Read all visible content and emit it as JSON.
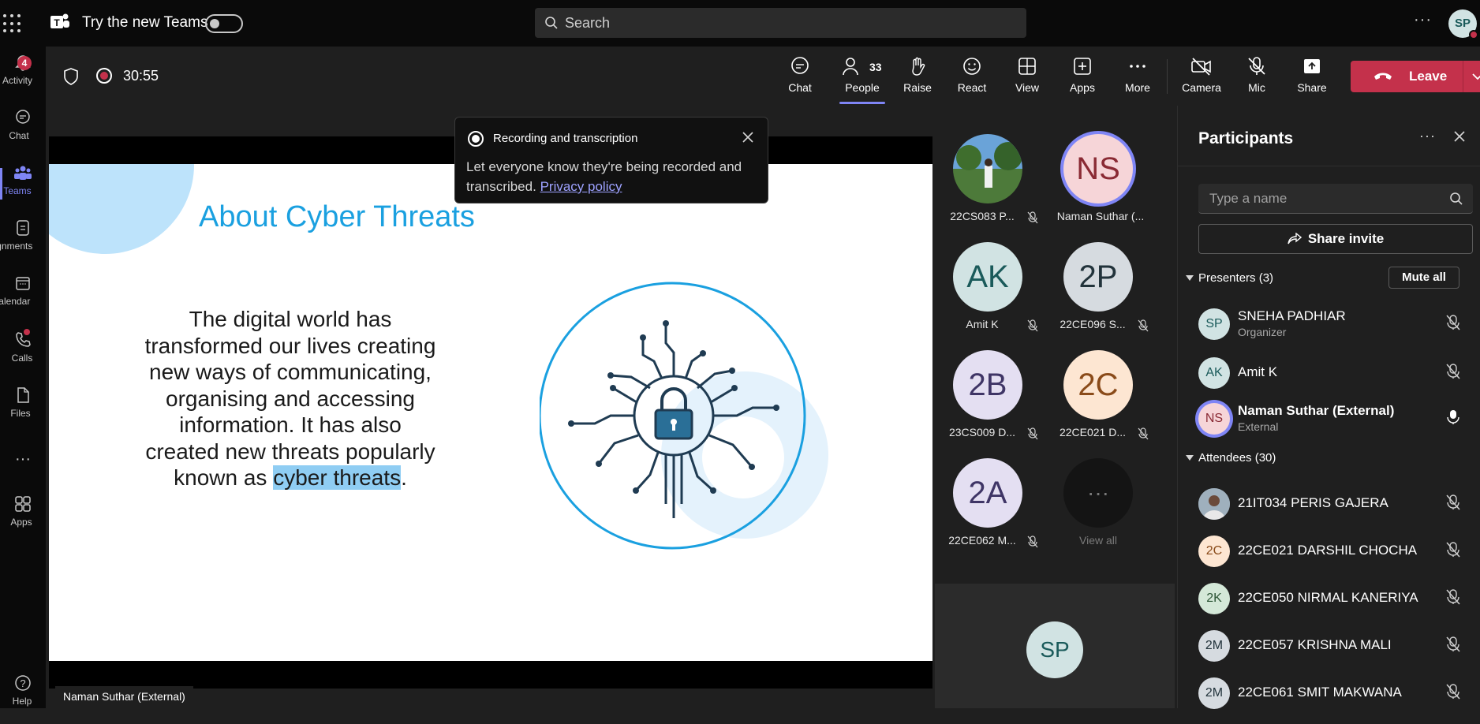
{
  "topbar": {
    "try_new_teams": "Try the new Teams",
    "search_placeholder": "Search",
    "me_initials": "SP"
  },
  "rail": {
    "activity": {
      "label": "Activity",
      "badge": "4"
    },
    "chat": {
      "label": "Chat"
    },
    "teams": {
      "label": "Teams"
    },
    "assignments": {
      "label": "Assignments"
    },
    "calendar": {
      "label": "Calendar"
    },
    "calls": {
      "label": "Calls"
    },
    "files": {
      "label": "Files"
    },
    "apps": {
      "label": "Apps"
    },
    "help": {
      "label": "Help"
    }
  },
  "meeting": {
    "timer": "30:55",
    "controls": {
      "chat": "Chat",
      "people": "People",
      "people_count": "33",
      "raise": "Raise",
      "react": "React",
      "view": "View",
      "apps": "Apps",
      "more": "More",
      "camera": "Camera",
      "mic": "Mic",
      "share": "Share",
      "leave": "Leave"
    }
  },
  "slide": {
    "title": "About Cyber Threats",
    "body": "The digital world has transformed our lives creating new ways of communicating, organising and accessing information. It has also created new threats popularly known as",
    "highlight": "cyber threats",
    "tail": "."
  },
  "presenter_label": "Naman Suthar (External)",
  "toast": {
    "title": "Recording and transcription",
    "body": "Let everyone know they're being recorded and transcribed.",
    "link": "Privacy policy"
  },
  "gallery": {
    "tiles": [
      {
        "initials": "",
        "name": "22CS083 P...",
        "muted": true,
        "photo": true
      },
      {
        "initials": "NS",
        "name": "Naman Suthar (...",
        "muted": false
      },
      {
        "initials": "AK",
        "name": "Amit K",
        "muted": true
      },
      {
        "initials": "2P",
        "name": "22CE096 S...",
        "muted": true
      },
      {
        "initials": "2B",
        "name": "23CS009 D...",
        "muted": true
      },
      {
        "initials": "2C",
        "name": "22CE021 D...",
        "muted": true
      },
      {
        "initials": "2A",
        "name": "22CE062 M...",
        "muted": true
      },
      {
        "initials": "···",
        "name": "View all",
        "muted": false
      }
    ],
    "self_initials": "SP"
  },
  "participants": {
    "title": "Participants",
    "search_placeholder": "Type a name",
    "share_invite": "Share invite",
    "presenters_header": "Presenters (3)",
    "mute_all": "Mute all",
    "presenters": [
      {
        "initials": "SP",
        "name": "SNEHA PADHIAR",
        "role": "Organizer"
      },
      {
        "initials": "AK",
        "name": "Amit K",
        "role": ""
      },
      {
        "initials": "NS",
        "name": "Naman Suthar (External)",
        "role": "External"
      }
    ],
    "attendees_header": "Attendees (30)",
    "attendees": [
      {
        "initials": "",
        "name": "21IT034 PERIS GAJERA"
      },
      {
        "initials": "2C",
        "name": "22CE021 DARSHIL CHOCHA"
      },
      {
        "initials": "2K",
        "name": "22CE050 NIRMAL KANERIYA"
      },
      {
        "initials": "2M",
        "name": "22CE057 KRISHNA MALI"
      },
      {
        "initials": "2M",
        "name": "22CE061 SMIT MAKWANA"
      }
    ]
  }
}
